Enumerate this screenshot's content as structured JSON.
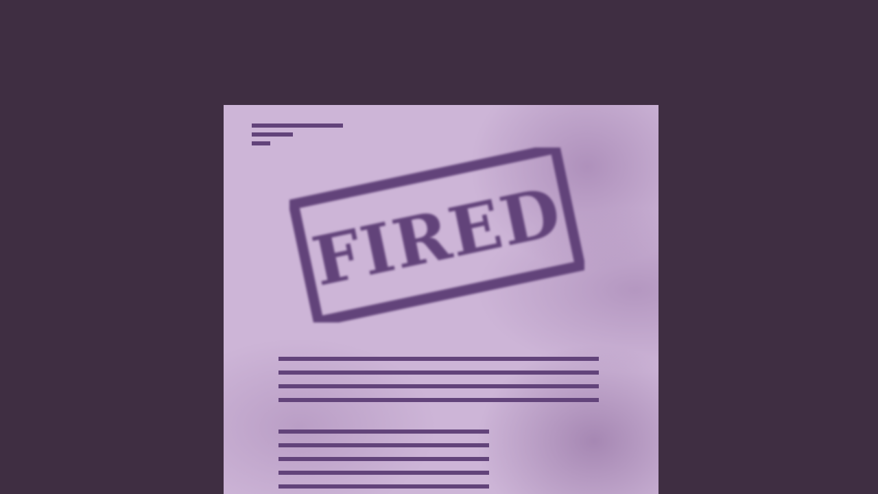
{
  "stamp": {
    "text": "FIRED",
    "color": "#62437a"
  },
  "colors": {
    "background": "#3f2e42",
    "paper": "#cdb5d7",
    "ink": "#62437a"
  }
}
